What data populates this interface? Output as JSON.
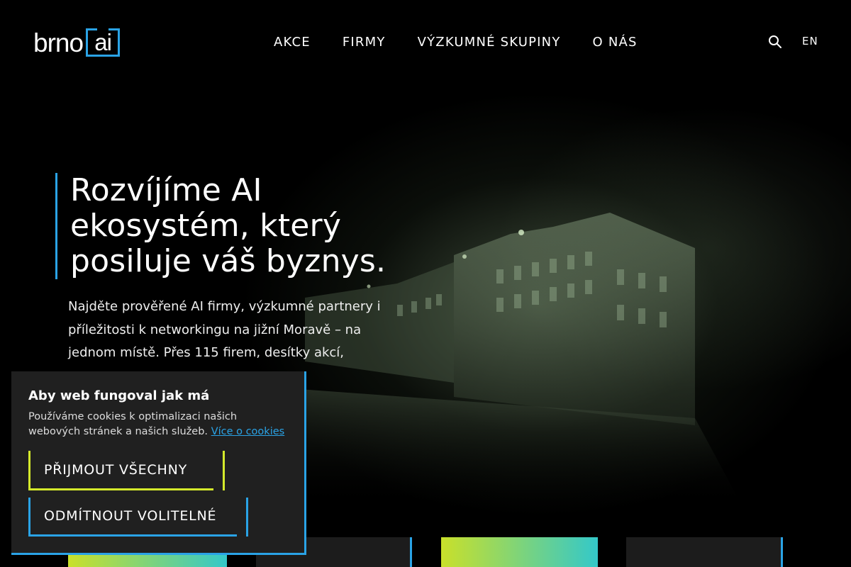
{
  "header": {
    "logo_text": "brno",
    "logo_box_text": "ai",
    "nav": [
      {
        "label": "AKCE"
      },
      {
        "label": "FIRMY"
      },
      {
        "label": "VÝZKUMNÉ SKUPINY"
      },
      {
        "label": "O NÁS"
      }
    ],
    "search_icon": "search-icon",
    "language": "EN"
  },
  "hero": {
    "title": "Rozvíjíme AI ekosystém, který posiluje váš byznys.",
    "description": "Najděte prověřené AI firmy, výzkumné partnery i příležitosti k networkingu na jižní Moravě – na jednom místě. Přes 115 firem, desítky akcí,"
  },
  "cookie": {
    "title": "Aby web fungoval jak má",
    "text": "Používáme cookies k optimalizaci našich webových stránek a našich služeb. ",
    "link": "Více o cookies",
    "accept": "PŘIJMOUT VŠECHNY",
    "reject": "ODMÍTNOUT VOLITELNÉ"
  },
  "colors": {
    "accent_blue": "#2aa3e6",
    "accent_yellow": "#d4e92b",
    "background": "#000000",
    "dialog_bg": "#202020"
  }
}
